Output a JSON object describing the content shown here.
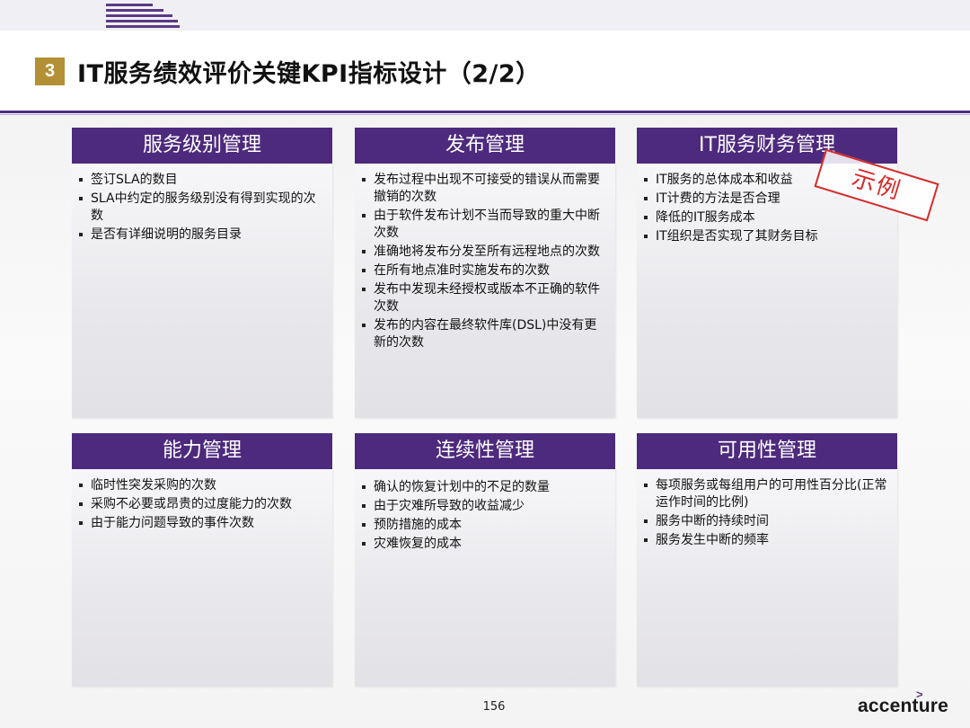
{
  "header": {
    "section_number": "3",
    "title": "IT服务绩效评价关键KPI指标设计（2/2）"
  },
  "cards": [
    {
      "title": "服务级别管理",
      "items": [
        "签订SLA的数目",
        "SLA中约定的服务级别没有得到实现的次数",
        "是否有详细说明的服务目录"
      ]
    },
    {
      "title": "发布管理",
      "items": [
        "发布过程中出现不可接受的错误从而需要撤销的次数",
        "由于软件发布计划不当而导致的重大中断次数",
        "准确地将发布分发至所有远程地点的次数",
        "在所有地点准时实施发布的次数",
        "发布中发现未经授权或版本不正确的软件次数",
        "发布的内容在最终软件库(DSL)中没有更新的次数"
      ]
    },
    {
      "title": "IT服务财务管理",
      "items": [
        "IT服务的总体成本和收益",
        "IT计费的方法是否合理",
        "降低的IT服务成本",
        "IT组织是否实现了其财务目标"
      ]
    },
    {
      "title": "能力管理",
      "items": [
        "临时性突发采购的次数",
        "采购不必要或昂贵的过度能力的次数",
        "由于能力问题导致的事件次数"
      ]
    },
    {
      "title": "连续性管理",
      "items": [
        "确认的恢复计划中的不足的数量",
        "由于灾难所导致的收益减少",
        "预防措施的成本",
        "灾难恢复的成本"
      ]
    },
    {
      "title": "可用性管理",
      "items": [
        "每项服务或每组用户的可用性百分比(正常运作时间的比例)",
        "服务中断的持续时间",
        "服务发生中断的频率"
      ]
    }
  ],
  "stamp": "示例",
  "footer": {
    "page_number": "156",
    "logo": "accenture",
    "logo_mark": ">"
  }
}
